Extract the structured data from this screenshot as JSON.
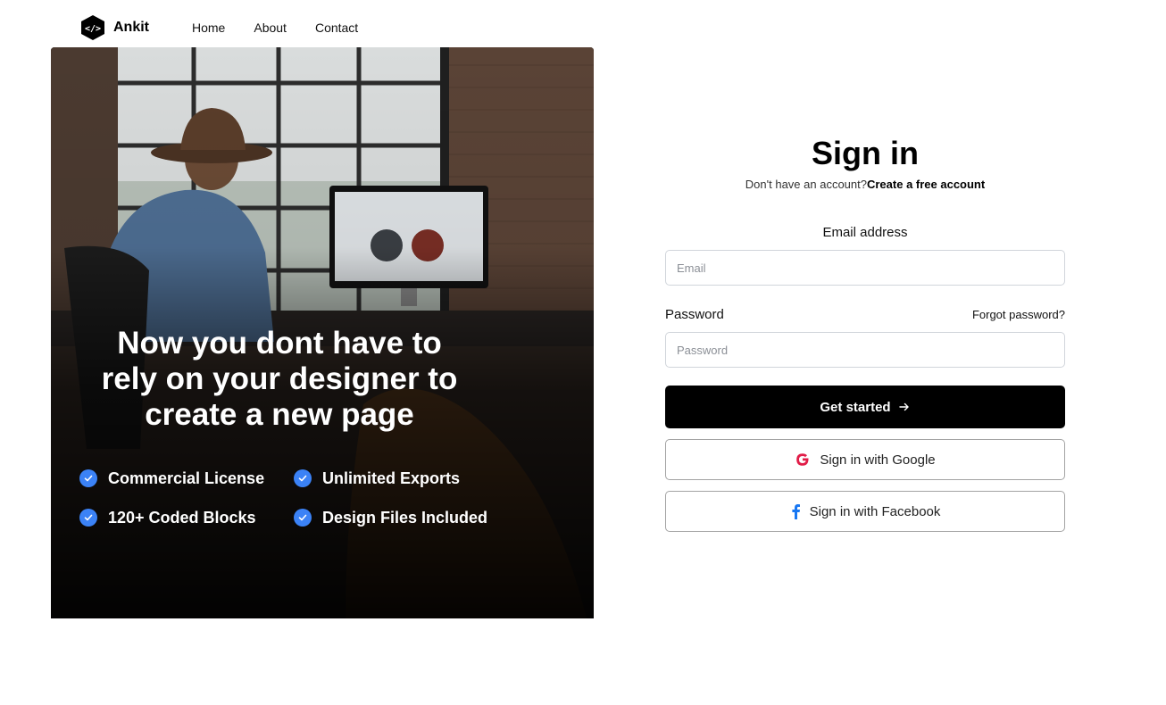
{
  "nav": {
    "brand": "Ankit",
    "links": [
      "Home",
      "About",
      "Contact"
    ]
  },
  "hero": {
    "heading": "Now you dont have to rely on your designer to create a new page",
    "features": [
      "Commercial License",
      "Unlimited Exports",
      "120+ Coded Blocks",
      "Design Files Included"
    ]
  },
  "form": {
    "title": "Sign in",
    "subtitle_prefix": "Don't have an account?",
    "subtitle_link": "Create a free account",
    "email_label": "Email address",
    "email_placeholder": "Email",
    "password_label": "Password",
    "forgot_label": "Forgot password?",
    "password_placeholder": "Password",
    "submit_label": "Get started",
    "google_label": "Sign in with Google",
    "facebook_label": "Sign in with Facebook"
  },
  "colors": {
    "accent": "#000000",
    "check": "#3b82f6",
    "google": "#e11d48",
    "facebook": "#1877f2"
  },
  "icons": [
    "code-hexagon-icon",
    "check-circle-icon",
    "arrow-right-icon",
    "google-icon",
    "facebook-icon"
  ]
}
